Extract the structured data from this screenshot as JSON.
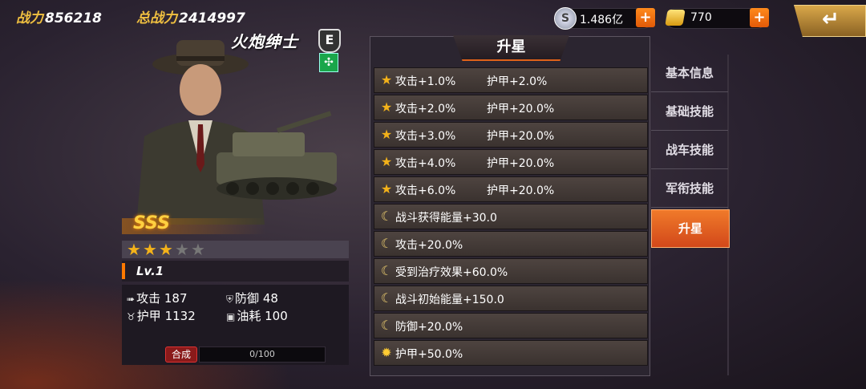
{
  "header": {
    "power_label": "战力",
    "power_value": "856218",
    "total_power_label": "总战力",
    "total_power_value": "2414997"
  },
  "resources": {
    "silver": {
      "value": "1.486亿",
      "icon": "silver-coin-icon",
      "add": "+"
    },
    "gold": {
      "value": "770",
      "icon": "gold-bar-icon",
      "add": "+"
    }
  },
  "back_button": {
    "icon": "return-arrow-icon",
    "label": "↵"
  },
  "hero": {
    "name": "火炮绅士",
    "class_badge": "E",
    "rank": "SSS",
    "stars": {
      "filled": 3,
      "total": 5
    },
    "level": "Lv.1",
    "stats": {
      "attack_label": "攻击",
      "attack_value": "187",
      "defense_label": "防御",
      "defense_value": "48",
      "armor_label": "护甲",
      "armor_value": "1132",
      "fuel_label": "油耗",
      "fuel_value": "100"
    },
    "merge_label": "合成",
    "merge_progress": "0/100",
    "merge_fraction": 0
  },
  "panel": {
    "title": "升星",
    "rows": [
      {
        "icon": "star",
        "a_label": "攻击+1.0%",
        "b_label": "护甲+2.0%"
      },
      {
        "icon": "star",
        "a_label": "攻击+2.0%",
        "b_label": "护甲+20.0%"
      },
      {
        "icon": "star",
        "a_label": "攻击+3.0%",
        "b_label": "护甲+20.0%"
      },
      {
        "icon": "star",
        "a_label": "攻击+4.0%",
        "b_label": "护甲+20.0%"
      },
      {
        "icon": "star",
        "a_label": "攻击+6.0%",
        "b_label": "护甲+20.0%"
      },
      {
        "icon": "moon",
        "a_label": "战斗获得能量+30.0",
        "b_label": ""
      },
      {
        "icon": "moon",
        "a_label": "攻击+20.0%",
        "b_label": ""
      },
      {
        "icon": "moon",
        "a_label": "受到治疗效果+60.0%",
        "b_label": ""
      },
      {
        "icon": "moon",
        "a_label": "战斗初始能量+150.0",
        "b_label": ""
      },
      {
        "icon": "moon",
        "a_label": "防御+20.0%",
        "b_label": ""
      },
      {
        "icon": "sun",
        "a_label": "护甲+50.0%",
        "b_label": ""
      }
    ]
  },
  "tabs": [
    {
      "label": "基本信息",
      "active": false
    },
    {
      "label": "基础技能",
      "active": false
    },
    {
      "label": "战车技能",
      "active": false
    },
    {
      "label": "军衔技能",
      "active": false
    },
    {
      "label": "升星",
      "active": true
    }
  ]
}
